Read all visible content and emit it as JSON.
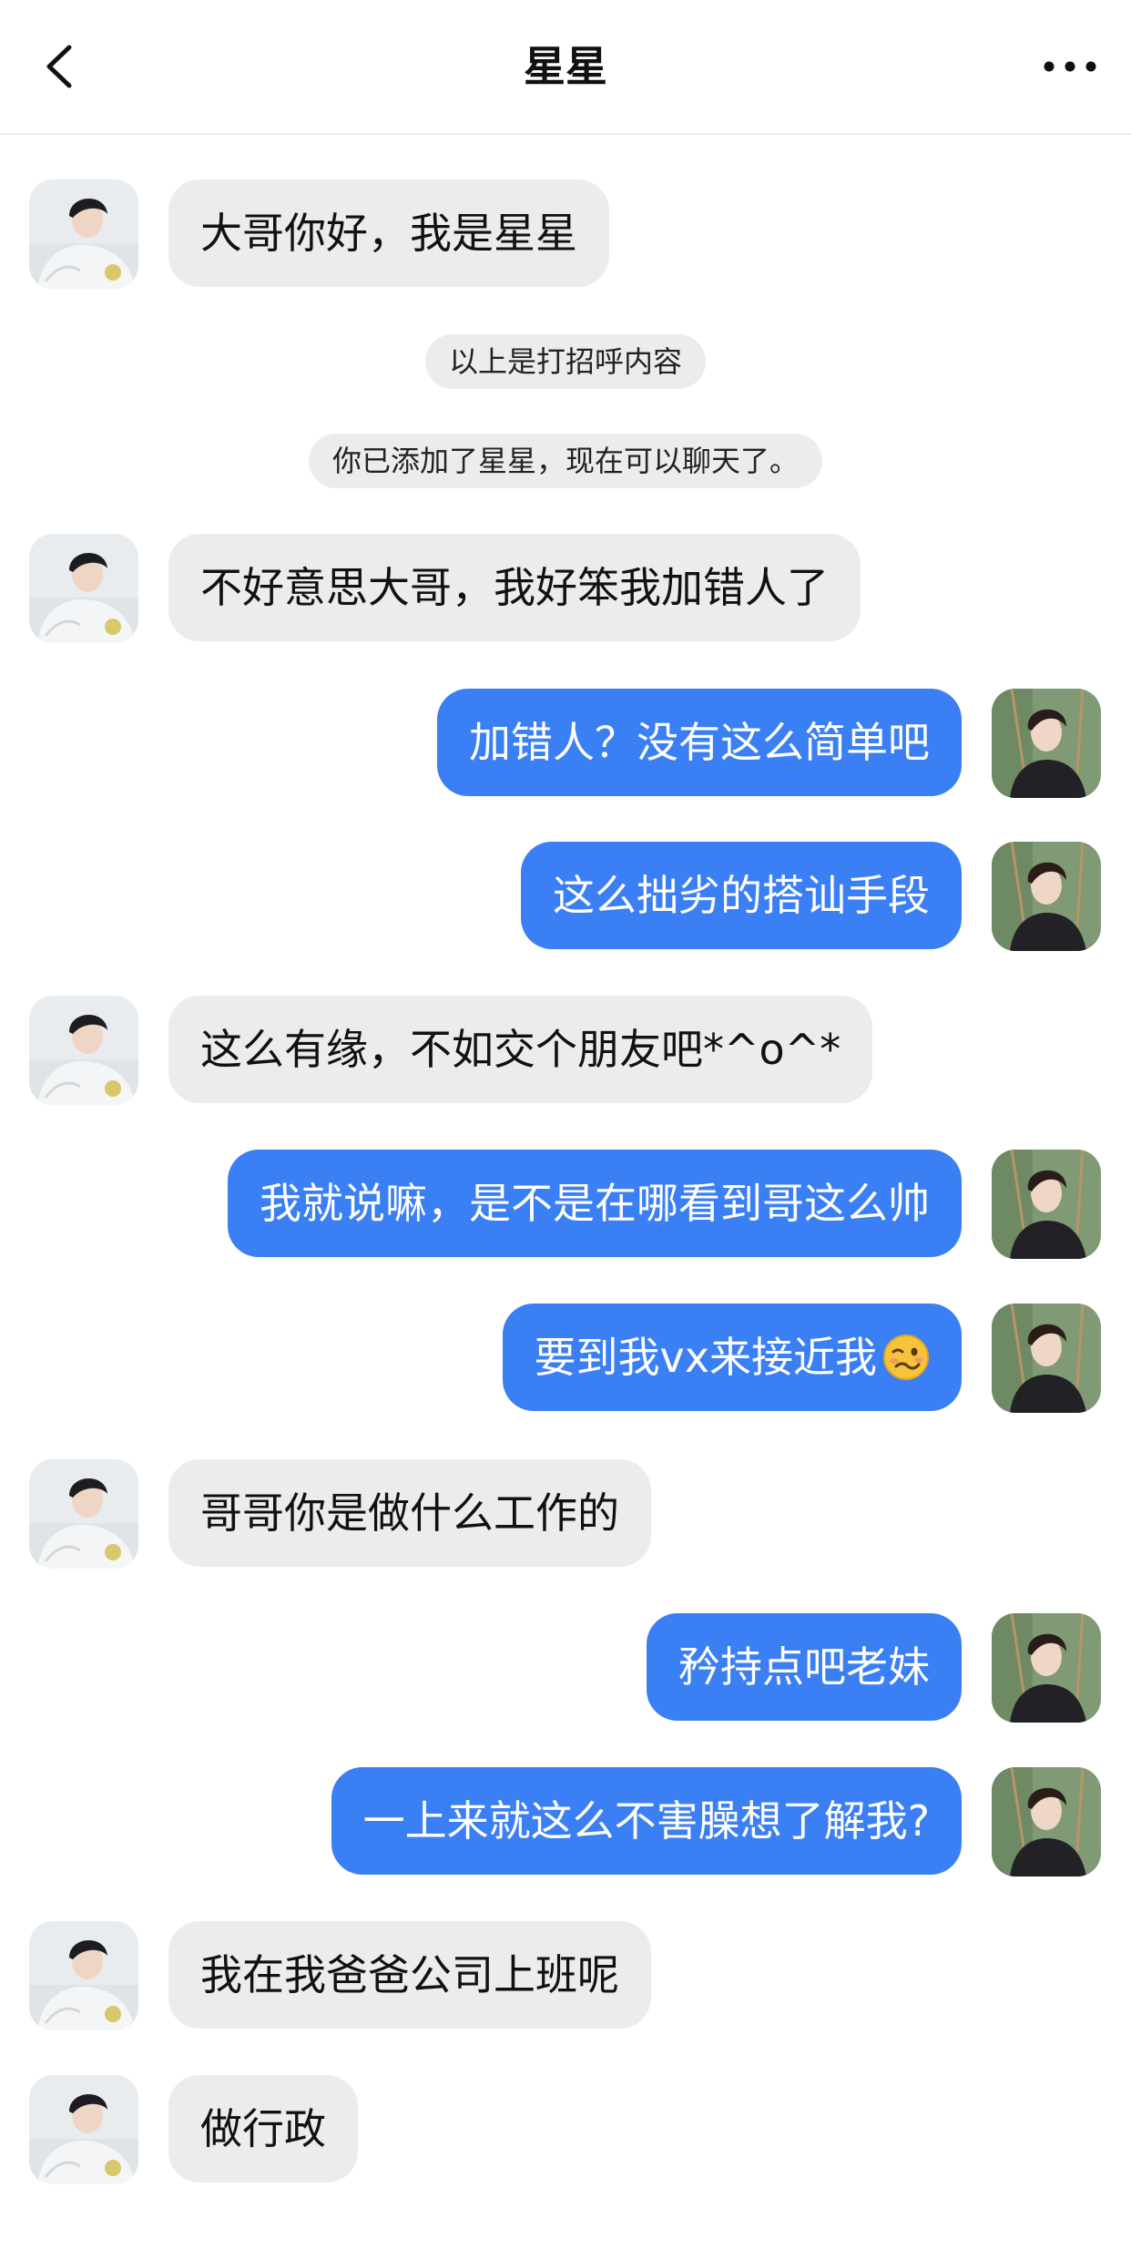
{
  "header": {
    "title": "星星",
    "back_icon": "chevron-left-icon",
    "more_icon": "more-horizontal-icon"
  },
  "system_messages": [
    "以上是打招呼内容",
    "你已添加了星星，现在可以聊天了。"
  ],
  "messages": [
    {
      "side": "left",
      "text": "大哥你好，我是星星"
    },
    {
      "side": "left",
      "text": "不好意思大哥，我好笨我加错人了"
    },
    {
      "side": "right",
      "text": "加错人？没有这么简单吧"
    },
    {
      "side": "right",
      "text": "这么拙劣的搭讪手段"
    },
    {
      "side": "left",
      "text": "这么有缘，不如交个朋友吧*^o^*"
    },
    {
      "side": "right",
      "text": "我就说嘛，是不是在哪看到哥这么帅"
    },
    {
      "side": "right",
      "text": "要到我vx来接近我",
      "emoji": "woozy-face-emoji"
    },
    {
      "side": "left",
      "text": "哥哥你是做什么工作的"
    },
    {
      "side": "right",
      "text": "矜持点吧老妹"
    },
    {
      "side": "right",
      "text": "一上来就这么不害臊想了解我?"
    },
    {
      "side": "left",
      "text": "我在我爸爸公司上班呢"
    },
    {
      "side": "left",
      "text": "做行政"
    }
  ],
  "colors": {
    "outgoing_bubble": "#3b7ff5",
    "incoming_bubble": "#ececec",
    "system_pill": "#ececec"
  }
}
